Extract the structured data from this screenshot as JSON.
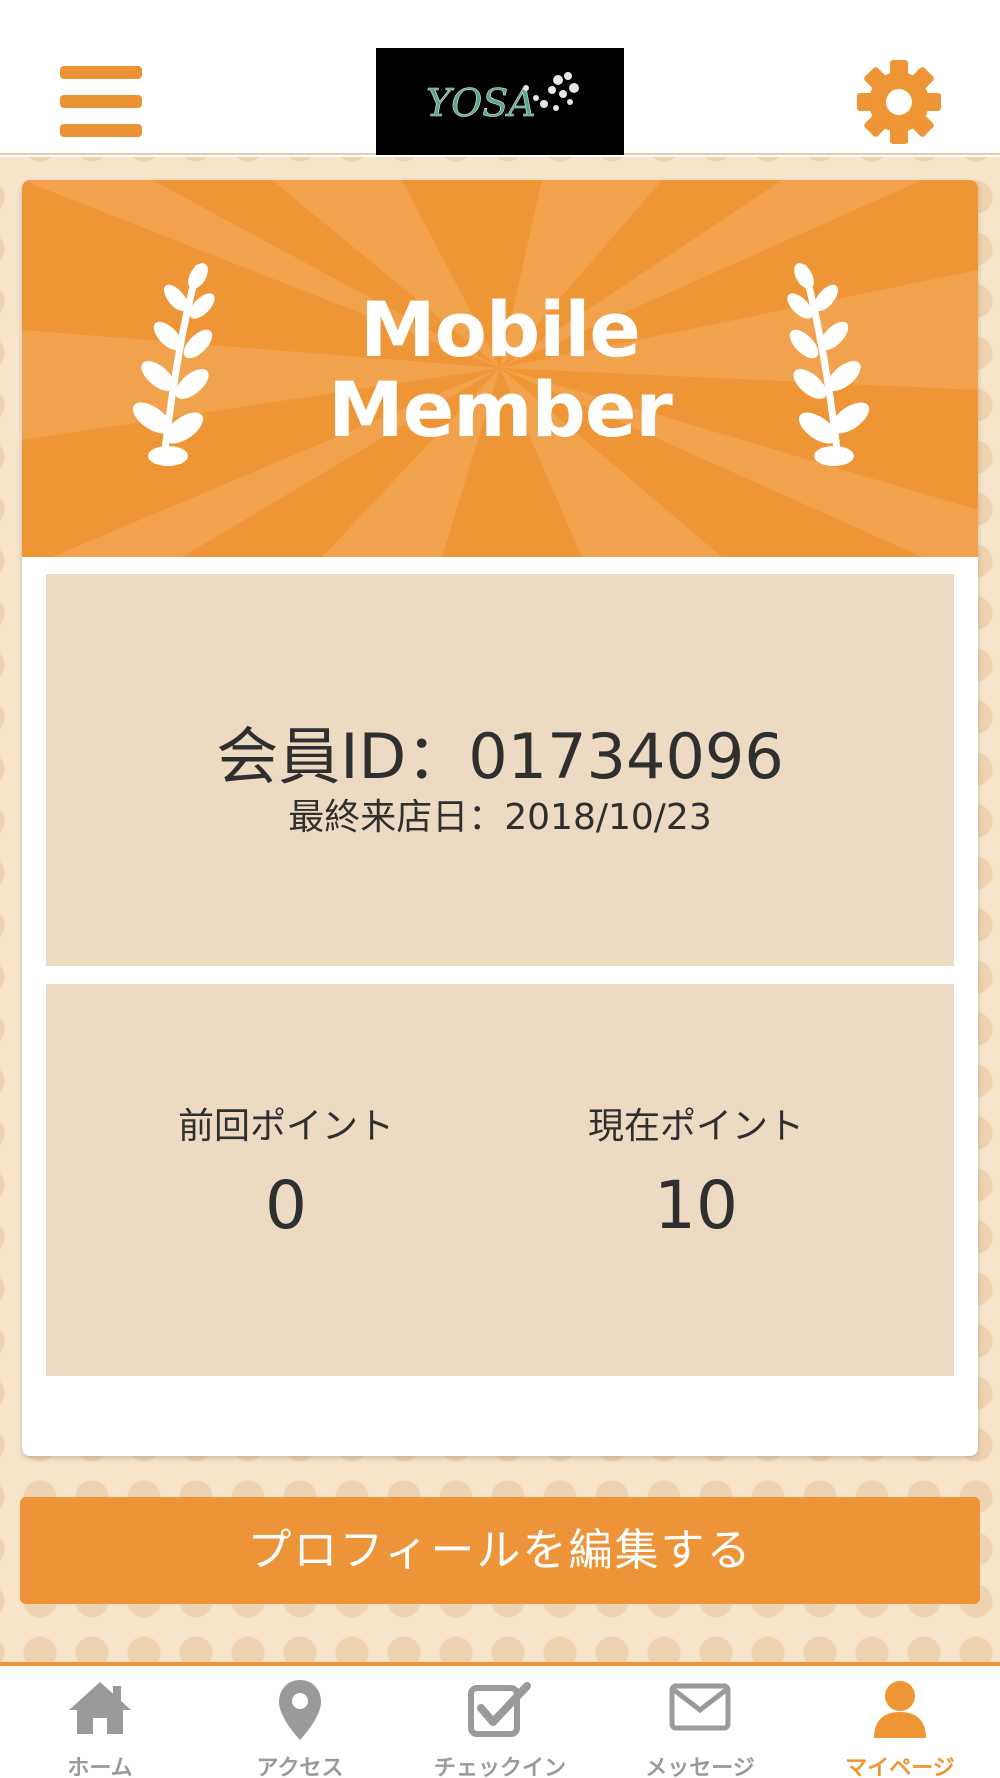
{
  "header": {
    "menu_icon": "hamburger-menu-icon",
    "logo_text": "YOSA",
    "settings_icon": "gear-icon"
  },
  "banner": {
    "line1": "Mobile",
    "line2": "Member"
  },
  "member": {
    "id_text": "会員ID：01734096",
    "last_visit_text": "最終来店日：2018/10/23"
  },
  "points": {
    "previous_label": "前回ポイント",
    "previous_value": "0",
    "current_label": "現在ポイント",
    "current_value": "10"
  },
  "edit_profile_label": "プロフィールを編集する",
  "tabs": [
    {
      "label": "ホーム",
      "icon": "home-icon"
    },
    {
      "label": "アクセス",
      "icon": "map-pin-icon"
    },
    {
      "label": "チェックイン",
      "icon": "checkbox-icon"
    },
    {
      "label": "メッセージ",
      "icon": "mail-icon"
    },
    {
      "label": "マイページ",
      "icon": "user-icon",
      "active": true
    }
  ],
  "colors": {
    "accent": "#ee9535",
    "panel": "#ecdbc2",
    "background": "#f6e4cb",
    "inactive_tab": "#9a9a9a"
  }
}
